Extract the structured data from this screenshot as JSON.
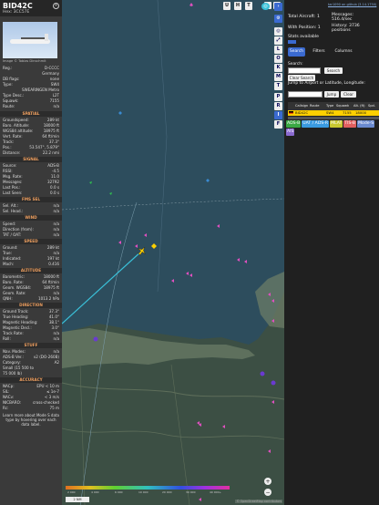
{
  "sidebar": {
    "callsign": "BID42C",
    "hex_line": "Hex:  3CC57E",
    "photo_credit": "Image © Tobias Dinschmit",
    "info_rows": [
      {
        "k": "Reg.:",
        "v": "D-CCCC"
      },
      {
        "k": "",
        "v": "Germany"
      },
      {
        "k": "DB flags:",
        "v": "none"
      },
      {
        "k": "Type:",
        "v": "SW4"
      },
      {
        "k": "",
        "v": "SWEARINGEN Metro"
      },
      {
        "k": "Type Desc.:",
        "v": "L2T"
      },
      {
        "k": "Squawk:",
        "v": "7155"
      },
      {
        "k": "Route:",
        "v": "n/a"
      }
    ],
    "sections": [
      {
        "title": "SPATIAL",
        "rows": [
          {
            "k": "Groundspeed:",
            "v": "289 kt"
          },
          {
            "k": "Baro. Altitude:",
            "v": "18000 ft"
          },
          {
            "k": "WGS84 altitude:",
            "v": "18975 ft"
          },
          {
            "k": "Vert. Rate:",
            "v": "64 ft/min"
          },
          {
            "k": "Track:",
            "v": "37.3°"
          },
          {
            "k": "Pos.:",
            "v": "53.547°, 5.879°"
          },
          {
            "k": "Distance:",
            "v": "22.2 nmi"
          }
        ]
      },
      {
        "title": "SIGNAL",
        "rows": [
          {
            "k": "Source:",
            "v": "ADS-B"
          },
          {
            "k": "RSSI:",
            "v": "-4.5"
          },
          {
            "k": "Msg. Rate:",
            "v": "11.0"
          },
          {
            "k": "Messages:",
            "v": "32792"
          },
          {
            "k": "Last Pos.:",
            "v": "0.0 s"
          },
          {
            "k": "Last Seen:",
            "v": "0.0 s"
          }
        ]
      },
      {
        "title": "FMS SEL",
        "rows": [
          {
            "k": "Sel. Alt.:",
            "v": "n/a"
          },
          {
            "k": "Sel. Head.:",
            "v": "n/a"
          }
        ]
      },
      {
        "title": "WIND",
        "rows": [
          {
            "k": "Speed:",
            "v": "n/a"
          },
          {
            "k": "Direction (from):",
            "v": "n/a"
          },
          {
            "k": "TAT / OAT:",
            "v": "n/a"
          }
        ]
      },
      {
        "title": "SPEED",
        "rows": [
          {
            "k": "Ground:",
            "v": "289 kt"
          },
          {
            "k": "True:",
            "v": "n/a"
          },
          {
            "k": "Indicated:",
            "v": "197 kt"
          },
          {
            "k": "Mach:",
            "v": "0.416"
          }
        ]
      },
      {
        "title": "ALTITUDE",
        "rows": [
          {
            "k": "Barometric:",
            "v": "18000 ft"
          },
          {
            "k": "Baro. Rate:",
            "v": "64 ft/min"
          },
          {
            "k": "Geom. WGS84:",
            "v": "18975 ft"
          },
          {
            "k": "Geom. Rate:",
            "v": "n/a"
          },
          {
            "k": "QNH:",
            "v": "1013.2 hPa"
          }
        ]
      },
      {
        "title": "DIRECTION",
        "rows": [
          {
            "k": "Ground Track:",
            "v": "37.3°"
          },
          {
            "k": "True Heading:",
            "v": "41.0°"
          },
          {
            "k": "Magnetic Heading:",
            "v": "38.1°"
          },
          {
            "k": "Magnetic Decl.:",
            "v": "3.0°"
          },
          {
            "k": "Track Rate:",
            "v": "n/a"
          },
          {
            "k": "Roll:",
            "v": "n/a"
          }
        ]
      },
      {
        "title": "STUFF",
        "rows": [
          {
            "k": "Nav. Modes:",
            "v": "n/a"
          },
          {
            "k": "ADS-B Ver.:",
            "v": "v2 (DO-260B)"
          },
          {
            "k": "Category:",
            "v": "A2"
          },
          {
            "k": "Small (15 500 to",
            "v": ""
          },
          {
            "k": "75 000 lb)",
            "v": ""
          }
        ]
      },
      {
        "title": "ACCURACY",
        "rows": [
          {
            "k": "NACp:",
            "v": "EPU < 10 m"
          },
          {
            "k": "SIL:",
            "v": "≤ 1e-7"
          },
          {
            "k": "NACv:",
            "v": "< 3 m/s"
          },
          {
            "k": "NICBARO:",
            "v": "cross-checked"
          },
          {
            "k": "Rc:",
            "v": "75 m"
          }
        ]
      }
    ],
    "footer": "Learn more about Mode S data type by hovering over each data label."
  },
  "map": {
    "top_buttons": [
      "U",
      "H",
      "T"
    ],
    "side_buttons": [
      "L",
      "O",
      "K",
      "M",
      "T",
      "P",
      "R",
      "I",
      "F"
    ],
    "scale_label": "2 NM",
    "altitude_ticks": [
      "2 000",
      "4 000",
      "6 000",
      "10 000",
      "20 000",
      "30 000",
      "40 000+"
    ],
    "attribution": "© OpenStreetMap contributors",
    "colors": {
      "water": "#2d4d5d",
      "land": "#3c4f44",
      "track": "#3ac0d8",
      "selected": "#ffd000"
    }
  },
  "panel": {
    "link_text": "tar1090 on github (3.14.1750)",
    "total_aircraft_label": "Total Aircraft:",
    "total_aircraft": "1",
    "with_position_label": "With Position:",
    "with_position": "1",
    "messages_label": "Messages:",
    "messages": "516.4/sec",
    "history_label": "History:",
    "history": "3736 positions",
    "stats_label": "Stats available",
    "tabs": [
      "Search",
      "Filters",
      "Columns"
    ],
    "search_label": "Search:",
    "search_button": "Search",
    "clear_search_button": "Clear Search",
    "jump_label": "Jump to Airport or Latitude, Longitude:",
    "jump_button": "Jump",
    "clear_button": "Clear",
    "columns": [
      "Callsign",
      "Route",
      "Type",
      "Squawk",
      "Alt. (ft)",
      "Spd."
    ],
    "row": {
      "callsign": "BID42C",
      "type": "SW4",
      "squawk": "7155",
      "alt": "18000"
    },
    "legend": [
      "ADS-B",
      "UAT / ADS-R",
      "MLAT",
      "TIS-B",
      "Mode-S",
      "AIS"
    ],
    "legend_colors": [
      "#3aa844",
      "#3a9ae0",
      "#c8c830",
      "#e06060",
      "#6a8ad0",
      "#8a6ad0"
    ]
  }
}
